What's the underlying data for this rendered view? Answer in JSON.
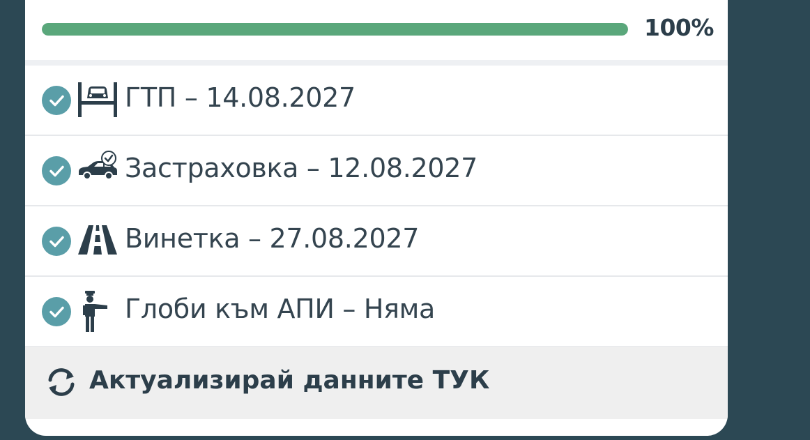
{
  "progress": {
    "percent_label": "100%",
    "fraction": 1.0,
    "fill_color": "#5aa77b"
  },
  "status_items": [
    {
      "icon": "car-lift-icon",
      "label": "ГТП – 14.08.2027",
      "status": "ok"
    },
    {
      "icon": "car-insurance-icon",
      "label": "Застраховка – 12.08.2027",
      "status": "ok"
    },
    {
      "icon": "road-icon",
      "label": "Винетка – 27.08.2027",
      "status": "ok"
    },
    {
      "icon": "traffic-officer-icon",
      "label": "Глоби към АПИ – Няма",
      "status": "ok"
    }
  ],
  "refresh": {
    "icon": "refresh-icon",
    "label": "Актуализирай данните ТУК"
  },
  "colors": {
    "background": "#2c4854",
    "check_badge": "#5a9ea8",
    "text": "#34444f"
  }
}
